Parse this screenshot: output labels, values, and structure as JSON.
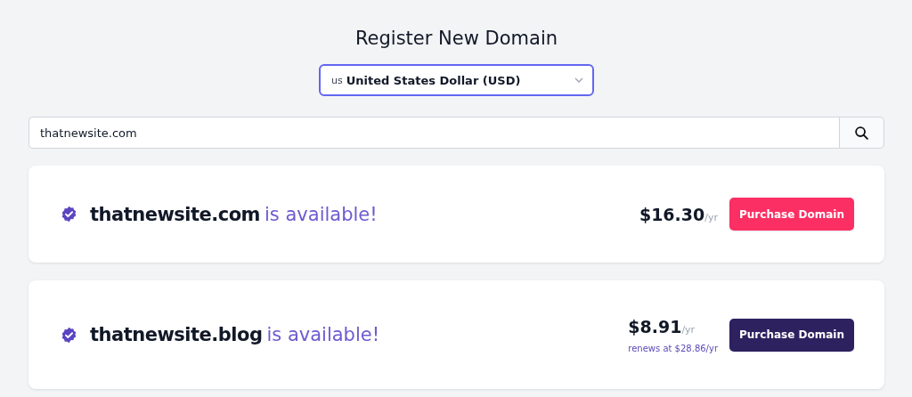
{
  "title": "Register New Domain",
  "currency": {
    "code": "us",
    "label": "United States Dollar (USD)"
  },
  "search": {
    "value": "thatnewsite.com"
  },
  "results": [
    {
      "kind": "featured",
      "domain": "thatnewsite.com",
      "status": "is available!",
      "price": "$16.30",
      "period": "/yr",
      "button": "Purchase Domain"
    },
    {
      "kind": "standard",
      "domain": "thatnewsite.blog",
      "status": "is available!",
      "price": "$8.91",
      "period": "/yr",
      "renewal": "renews at $28.86/yr",
      "button": "Purchase Domain"
    }
  ]
}
